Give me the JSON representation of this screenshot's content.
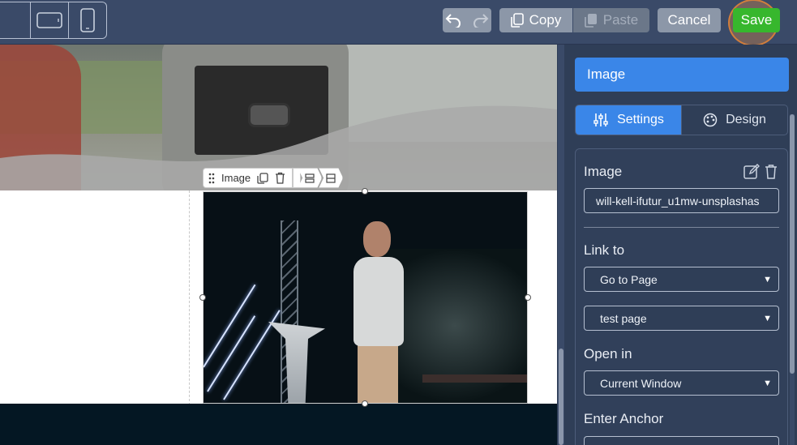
{
  "toolbar": {
    "copy_label": "Copy",
    "paste_label": "Paste",
    "cancel_label": "Cancel",
    "save_label": "Save"
  },
  "element_toolbar": {
    "label": "Image"
  },
  "panel": {
    "header": "Image",
    "tabs": [
      {
        "label": "Settings",
        "active": true
      },
      {
        "label": "Design",
        "active": false
      }
    ],
    "image_label": "Image",
    "image_filename": "will-kell-ifutur_u1mw-unsplashas",
    "link_to_label": "Link to",
    "link_to_value": "Go to Page",
    "page_value": "test page",
    "open_in_label": "Open in",
    "open_in_value": "Current Window",
    "anchor_label": "Enter Anchor"
  },
  "colors": {
    "accent": "#3a86e8",
    "save": "#37b72d",
    "panel_bg": "#2f3e57"
  }
}
